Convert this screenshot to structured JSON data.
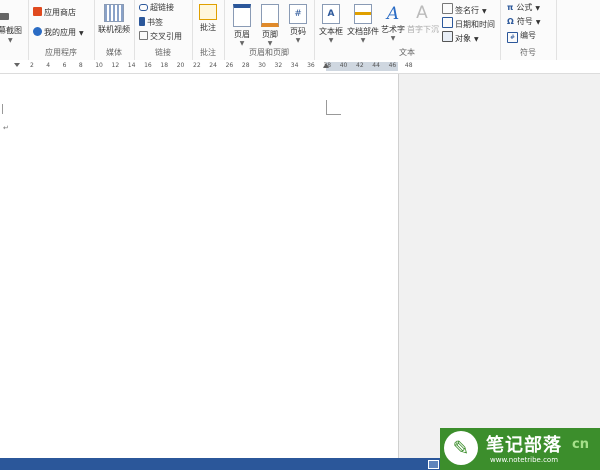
{
  "ribbon": {
    "screenshot_label": "幕截图",
    "apps": {
      "store": "应用商店",
      "my_apps": "我的应用",
      "label": "应用程序"
    },
    "media": {
      "online_video": "联机视频",
      "label": "媒体"
    },
    "links": {
      "hyperlink": "超链接",
      "bookmark": "书签",
      "cross_ref": "交叉引用",
      "label": "链接"
    },
    "comments": {
      "comment": "批注",
      "label": "批注"
    },
    "header_footer": {
      "header": "页眉",
      "footer": "页脚",
      "page_number": "页码",
      "label": "页眉和页脚"
    },
    "text": {
      "textbox": "文本框",
      "doc_parts": "文档部件",
      "wordart": "艺术字",
      "drop_cap": "首字下沉",
      "signature": "签名行",
      "datetime": "日期和时间",
      "object": "对象",
      "label": "文本"
    },
    "symbols": {
      "equation": "公式",
      "symbol": "符号",
      "number": "编号",
      "label": "符号"
    }
  },
  "ruler_ticks": [
    "2",
    "4",
    "6",
    "8",
    "10",
    "12",
    "14",
    "16",
    "18",
    "20",
    "22",
    "24",
    "26",
    "28",
    "30",
    "32",
    "34",
    "36",
    "38",
    "40",
    "42",
    "44",
    "46",
    "48"
  ],
  "document": {
    "paragraph_mark": "↵"
  },
  "watermark": {
    "brand": "笔记部落",
    "domain": "www.notetribe.com",
    "suffix": "cn"
  },
  "colors": {
    "accent": "#2b579a",
    "status_bar": "#2b579a",
    "watermark_bg": "#3c8e2c"
  }
}
